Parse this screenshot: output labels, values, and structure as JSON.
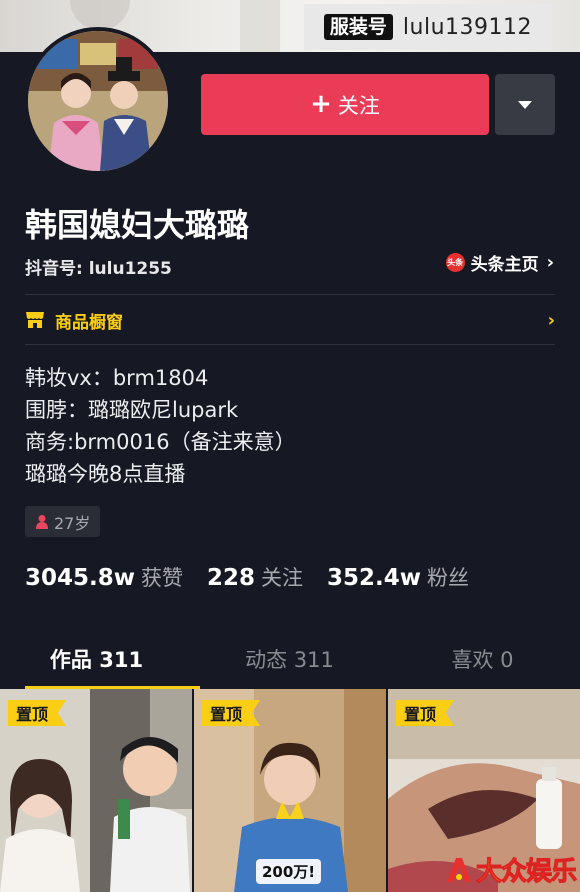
{
  "banner": {
    "tag": "服装号",
    "value": "lulu139112"
  },
  "profile": {
    "nickname": "韩国媳妇大璐璐",
    "douyin_id": "抖音号: lulu1255",
    "toutiao_icon": "头条",
    "toutiao_label": "头条主页"
  },
  "actions": {
    "follow_label": "关注",
    "follow_icon": "+"
  },
  "shop": {
    "label": "商品橱窗",
    "icon": "shop-icon"
  },
  "bio": [
    "韩妆vx：brm1804",
    "围脖：璐璐欧尼lupark",
    "商务:brm0016（备注来意）",
    "璐璐今晚8点直播"
  ],
  "age_tag": "27岁",
  "stats": [
    {
      "value": "3045.8w",
      "label": "获赞"
    },
    {
      "value": "228",
      "label": "关注"
    },
    {
      "value": "352.4w",
      "label": "粉丝"
    }
  ],
  "tabs": [
    {
      "label": "作品 311",
      "active": true
    },
    {
      "label": "动态 311",
      "active": false
    },
    {
      "label": "喜欢 0",
      "active": false
    }
  ],
  "videos": [
    {
      "pin": "置顶"
    },
    {
      "pin": "置顶",
      "caption": "200万!"
    },
    {
      "pin": "置顶"
    }
  ],
  "watermark": "大众娱乐",
  "colors": {
    "background": "#161823",
    "follow": "#ea3c57",
    "accent": "#face15"
  }
}
